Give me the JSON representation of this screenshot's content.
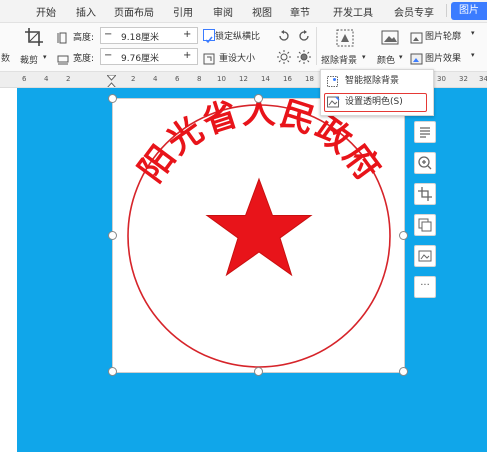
{
  "tabs": [
    "开始",
    "插入",
    "页面布局",
    "引用",
    "审阅",
    "视图",
    "章节",
    "开发工具",
    "会员专享"
  ],
  "active_tab": "图片",
  "ribbon": {
    "crop_label": "裁剪",
    "height_label": "高度:",
    "height_value": "9.18厘米",
    "width_label": "宽度:",
    "width_value": "9.76厘米",
    "lock_ratio_label": "锁定纵横比",
    "reset_size_label": "重设大小",
    "remove_bg_label": "抠除背景",
    "color_label": "颜色",
    "picture_outline_label": "图片轮廓",
    "picture_effect_label": "图片效果",
    "minus": "−",
    "plus": "+",
    "chevron": "▾",
    "left_partial": "数"
  },
  "ruler_numbers": [
    "6",
    "4",
    "2",
    "",
    "2",
    "4",
    "6",
    "8",
    "10",
    "12",
    "14",
    "16",
    "18",
    "20",
    "22",
    "24",
    "26",
    "28",
    "30",
    "32",
    "34"
  ],
  "dropdown": {
    "smart_remove_label": "智能抠除背景",
    "set_transparent_label": "设置透明色(S)"
  },
  "seal_text": "阳光省人民政府",
  "side_more": "···",
  "colors": {
    "accent": "#3b7cff",
    "page_bg": "#10a6ea",
    "seal_red": "#e8141a",
    "highlight": "#e53935"
  }
}
